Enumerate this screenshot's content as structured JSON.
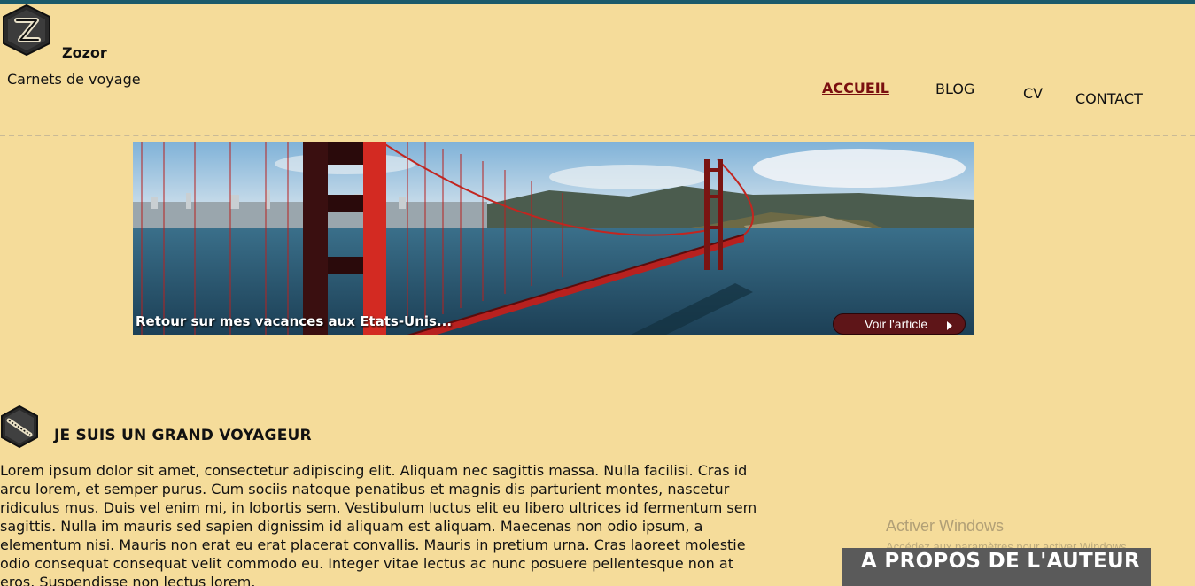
{
  "header": {
    "site_name": "Zozor",
    "tagline": "Carnets de voyage",
    "logo_icon": "zozor-logo-icon"
  },
  "nav": {
    "items": [
      {
        "label": "ACCUEIL",
        "active": true
      },
      {
        "label": "BLOG",
        "active": false
      },
      {
        "label": "CV",
        "active": false
      },
      {
        "label": "CONTACT",
        "active": false
      }
    ]
  },
  "banner": {
    "caption": "Retour sur mes vacances aux Etats-Unis...",
    "button_label": "Voir l'article",
    "button_icon": "arrow-right-icon",
    "image": "golden-gate-bridge-photo"
  },
  "section": {
    "icon": "ticket-icon",
    "title": "JE SUIS UN GRAND VOYAGEUR",
    "body": "Lorem ipsum dolor sit amet, consectetur adipiscing elit. Aliquam nec sagittis massa. Nulla facilisi. Cras id arcu lorem, et semper purus. Cum sociis natoque penatibus et magnis dis parturient montes, nascetur ridiculus mus. Duis vel enim mi, in lobortis sem. Vestibulum luctus elit eu libero ultrices id fermentum sem sagittis. Nulla im mauris sed sapien dignissim id aliquam est aliquam. Maecenas non odio ipsum, a elementum nisi. Mauris non erat eu erat placerat convallis. Mauris in pretium urna. Cras laoreet molestie odio consequat consequat velit commodo eu. Integer vitae lectus ac nunc posuere pellentesque non at eros. Suspendisse non lectus lorem."
  },
  "aside": {
    "title": "A PROPOS DE L'AUTEUR"
  },
  "watermark": {
    "title": "Activer Windows",
    "subtitle": "Accédez aux paramètres pour activer Windows."
  },
  "colors": {
    "background": "#f5dc9a",
    "accent": "#7a1010",
    "top_strip": "#1c5a6a",
    "button": "#5e1518",
    "aside_box": "#5a5a5a"
  }
}
